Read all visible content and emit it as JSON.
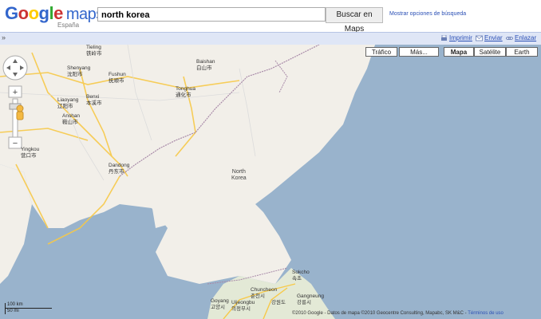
{
  "header": {
    "logo_google": "Google",
    "logo_maps": "maps",
    "region": "España",
    "search_value": "north korea",
    "search_button": "Buscar en Maps",
    "search_options": "Mostrar opciones de búsqueda"
  },
  "toolbar": {
    "print": "Imprimir",
    "send": "Enviar",
    "link": "Enlazar",
    "collapse": "»"
  },
  "map_types": [
    {
      "label": "Tráfico",
      "active": false
    },
    {
      "label": "Más...",
      "active": false
    },
    {
      "label": "Mapa",
      "active": true
    },
    {
      "label": "Satélite",
      "active": false
    },
    {
      "label": "Earth",
      "active": false
    }
  ],
  "places": {
    "tieling": "Tieling\n铁岭市",
    "shenyang": "Shenyang\n沈阳市",
    "fushun": "Fushun\n抚顺市",
    "liaoyang": "Liaoyang\n辽阳市",
    "benxi": "Benxi\n本溪市",
    "anshan": "Anshan\n鞍山市",
    "baishan": "Baishan\n白山市",
    "tonghua": "Tonghua\n通化市",
    "dandong": "Dandong\n丹东市",
    "yingkou": "Yingkou\n营口市",
    "north_korea": "North\nKorea",
    "sokcho": "Sokcho\n속초",
    "chuncheon": "Chuncheon\n춘천시",
    "gangneung": "Gangneung\n강릉시",
    "goyang": "Goyang\n고양시",
    "uijeongbu": "Uijeongbu\n의정부시",
    "gangwon": "강원도"
  },
  "scale": {
    "km": "100 km",
    "mi": "50 mi"
  },
  "footer": {
    "copyright": "©2010 Google - Datos de mapa ©2010 Geocentre Consulting, Mapabc, SK M&C -",
    "terms": "Términos de uso"
  }
}
